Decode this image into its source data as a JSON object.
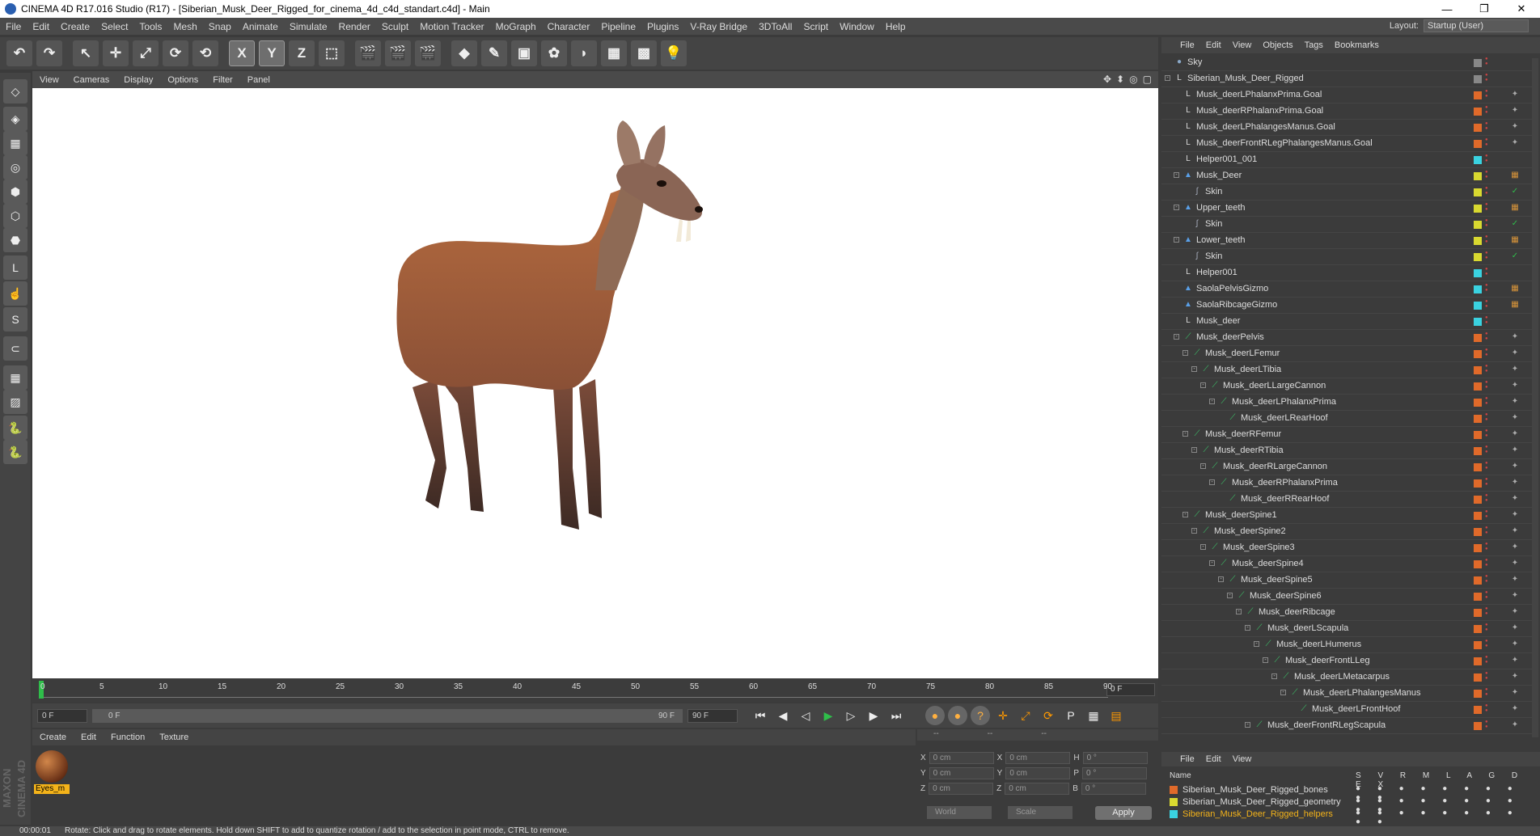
{
  "window": {
    "title": "CINEMA 4D R17.016 Studio (R17) - [Siberian_Musk_Deer_Rigged_for_cinema_4d_c4d_standart.c4d] - Main",
    "controls": [
      "—",
      "❐",
      "✕"
    ]
  },
  "menu": [
    "File",
    "Edit",
    "Create",
    "Select",
    "Tools",
    "Mesh",
    "Snap",
    "Animate",
    "Simulate",
    "Render",
    "Sculpt",
    "Motion Tracker",
    "MoGraph",
    "Character",
    "Pipeline",
    "Plugins",
    "V-Ray Bridge",
    "3DToAll",
    "Script",
    "Window",
    "Help"
  ],
  "layout": {
    "label": "Layout:",
    "value": "Startup (User)"
  },
  "toolbar": {
    "icons": [
      "undo-icon",
      "redo-icon",
      "select-icon",
      "move-icon",
      "scale-icon",
      "rotate-icon",
      "recent-tool-icon",
      "x-axis-icon",
      "y-axis-icon",
      "z-axis-icon",
      "coordinate-system-icon",
      "render-view-icon",
      "render-picture-viewer-icon",
      "render-settings-icon",
      "cube-icon",
      "pen-icon",
      "subdivision-icon",
      "cloner-icon",
      "deformer-icon",
      "floor-icon",
      "camera-icon",
      "light-icon"
    ],
    "glyphs": [
      "↶",
      "↷",
      "↖",
      "✛",
      "⤢",
      "⟳",
      "⟲",
      "X",
      "Y",
      "Z",
      "⬚",
      "🎬",
      "🎬",
      "🎬",
      "◆",
      "✎",
      "▣",
      "✿",
      "◗",
      "▦",
      "▩",
      "💡"
    ]
  },
  "left_tools": [
    "make-editable-icon",
    "model-mode-icon",
    "texture-mode-icon",
    "workplane-icon",
    "points-mode-icon",
    "edges-mode-icon",
    "polygons-mode-icon",
    "axis-mode-icon",
    "tweak-mode-icon",
    "solo-icon",
    "snap-icon",
    "workplane-lock-icon",
    "workplane-align-icon",
    "python-icon",
    "python-script-icon"
  ],
  "left_glyphs": [
    "◇",
    "◈",
    "▦",
    "◎",
    "⬢",
    "⬡",
    "⬣",
    "L",
    "☝",
    "S",
    "⊂",
    "▦",
    "▨",
    "🐍",
    "🐍"
  ],
  "viewport": {
    "menu": [
      "View",
      "Cameras",
      "Display",
      "Options",
      "Filter",
      "Panel"
    ],
    "controls": [
      "✥",
      "⬍",
      "◎",
      "▢"
    ]
  },
  "timeline": {
    "ticks": [
      "0",
      "5",
      "10",
      "15",
      "20",
      "25",
      "30",
      "35",
      "40",
      "45",
      "50",
      "55",
      "60",
      "65",
      "70",
      "75",
      "80",
      "85",
      "90"
    ],
    "current_frame": "0 F"
  },
  "transport": {
    "start_field": "0 F",
    "range_start": "0 F",
    "range_end": "90 F",
    "end_field": "90 F",
    "buttons": [
      "⏮",
      "◀",
      "◁",
      "▶",
      "▷",
      "▶",
      "⏭"
    ]
  },
  "materials": {
    "menu": [
      "Create",
      "Edit",
      "Function",
      "Texture"
    ],
    "items": [
      {
        "name": "Eyes_m"
      }
    ],
    "brand": "MAXON CINEMA 4D"
  },
  "coords": {
    "headers": [
      "--",
      "--",
      "--"
    ],
    "rows": [
      {
        "a": "X",
        "av": "0 cm",
        "b": "X",
        "bv": "0 cm",
        "c": "H",
        "cv": "0 °"
      },
      {
        "a": "Y",
        "av": "0 cm",
        "b": "Y",
        "bv": "0 cm",
        "c": "P",
        "cv": "0 °"
      },
      {
        "a": "Z",
        "av": "0 cm",
        "b": "Z",
        "bv": "0 cm",
        "c": "B",
        "cv": "0 °"
      }
    ],
    "mode1": "World",
    "mode2": "Scale",
    "apply": "Apply"
  },
  "status": {
    "time": "00:00:01",
    "text": "Rotate: Click and drag to rotate elements. Hold down SHIFT to add to quantize rotation / add to the selection in point mode, CTRL to remove."
  },
  "objects": {
    "menu": [
      "File",
      "Edit",
      "View",
      "Objects",
      "Tags",
      "Bookmarks"
    ],
    "rows": [
      {
        "name": "Sky",
        "depth": 0,
        "icon": "sky",
        "color": "#888888",
        "toggle": ""
      },
      {
        "name": "Siberian_Musk_Deer_Rigged",
        "depth": 0,
        "icon": "null",
        "color": "#888888",
        "toggle": "-"
      },
      {
        "name": "Musk_deerLPhalanxPrima.Goal",
        "depth": 1,
        "icon": "null",
        "color": "#e06a2a",
        "toggle": ""
      },
      {
        "name": "Musk_deerRPhalanxPrima.Goal",
        "depth": 1,
        "icon": "null",
        "color": "#e06a2a",
        "toggle": ""
      },
      {
        "name": "Musk_deerLPhalangesManus.Goal",
        "depth": 1,
        "icon": "null",
        "color": "#e06a2a",
        "toggle": ""
      },
      {
        "name": "Musk_deerFrontRLegPhalangesManus.Goal",
        "depth": 1,
        "icon": "null",
        "color": "#e06a2a",
        "toggle": ""
      },
      {
        "name": "Helper001_001",
        "depth": 1,
        "icon": "null",
        "color": "#3ad2e0",
        "toggle": ""
      },
      {
        "name": "Musk_Deer",
        "depth": 1,
        "icon": "poly",
        "color": "#d9d930",
        "toggle": "-"
      },
      {
        "name": "Skin",
        "depth": 2,
        "icon": "skin",
        "color": "#d9d930",
        "toggle": ""
      },
      {
        "name": "Upper_teeth",
        "depth": 1,
        "icon": "poly",
        "color": "#d9d930",
        "toggle": "-"
      },
      {
        "name": "Skin",
        "depth": 2,
        "icon": "skin",
        "color": "#d9d930",
        "toggle": ""
      },
      {
        "name": "Lower_teeth",
        "depth": 1,
        "icon": "poly",
        "color": "#d9d930",
        "toggle": "-"
      },
      {
        "name": "Skin",
        "depth": 2,
        "icon": "skin",
        "color": "#d9d930",
        "toggle": ""
      },
      {
        "name": "Helper001",
        "depth": 1,
        "icon": "null",
        "color": "#3ad2e0",
        "toggle": ""
      },
      {
        "name": "SaolaPelvisGizmo",
        "depth": 1,
        "icon": "poly",
        "color": "#3ad2e0",
        "toggle": ""
      },
      {
        "name": "SaolaRibcageGizmo",
        "depth": 1,
        "icon": "poly",
        "color": "#3ad2e0",
        "toggle": ""
      },
      {
        "name": "Musk_deer",
        "depth": 1,
        "icon": "null",
        "color": "#3ad2e0",
        "toggle": ""
      },
      {
        "name": "Musk_deerPelvis",
        "depth": 1,
        "icon": "bone",
        "color": "#e06a2a",
        "toggle": "-"
      },
      {
        "name": "Musk_deerLFemur",
        "depth": 2,
        "icon": "bone",
        "color": "#e06a2a",
        "toggle": "-"
      },
      {
        "name": "Musk_deerLTibia",
        "depth": 3,
        "icon": "bone",
        "color": "#e06a2a",
        "toggle": "-"
      },
      {
        "name": "Musk_deerLLargeCannon",
        "depth": 4,
        "icon": "bone",
        "color": "#e06a2a",
        "toggle": "-"
      },
      {
        "name": "Musk_deerLPhalanxPrima",
        "depth": 5,
        "icon": "bone",
        "color": "#e06a2a",
        "toggle": "-"
      },
      {
        "name": "Musk_deerLRearHoof",
        "depth": 6,
        "icon": "bone",
        "color": "#e06a2a",
        "toggle": ""
      },
      {
        "name": "Musk_deerRFemur",
        "depth": 2,
        "icon": "bone",
        "color": "#e06a2a",
        "toggle": "-"
      },
      {
        "name": "Musk_deerRTibia",
        "depth": 3,
        "icon": "bone",
        "color": "#e06a2a",
        "toggle": "-"
      },
      {
        "name": "Musk_deerRLargeCannon",
        "depth": 4,
        "icon": "bone",
        "color": "#e06a2a",
        "toggle": "-"
      },
      {
        "name": "Musk_deerRPhalanxPrima",
        "depth": 5,
        "icon": "bone",
        "color": "#e06a2a",
        "toggle": "-"
      },
      {
        "name": "Musk_deerRRearHoof",
        "depth": 6,
        "icon": "bone",
        "color": "#e06a2a",
        "toggle": ""
      },
      {
        "name": "Musk_deerSpine1",
        "depth": 2,
        "icon": "bone",
        "color": "#e06a2a",
        "toggle": "-"
      },
      {
        "name": "Musk_deerSpine2",
        "depth": 3,
        "icon": "bone",
        "color": "#e06a2a",
        "toggle": "-"
      },
      {
        "name": "Musk_deerSpine3",
        "depth": 4,
        "icon": "bone",
        "color": "#e06a2a",
        "toggle": "-"
      },
      {
        "name": "Musk_deerSpine4",
        "depth": 5,
        "icon": "bone",
        "color": "#e06a2a",
        "toggle": "-"
      },
      {
        "name": "Musk_deerSpine5",
        "depth": 6,
        "icon": "bone",
        "color": "#e06a2a",
        "toggle": "-"
      },
      {
        "name": "Musk_deerSpine6",
        "depth": 7,
        "icon": "bone",
        "color": "#e06a2a",
        "toggle": "-"
      },
      {
        "name": "Musk_deerRibcage",
        "depth": 8,
        "icon": "bone",
        "color": "#e06a2a",
        "toggle": "-"
      },
      {
        "name": "Musk_deerLScapula",
        "depth": 9,
        "icon": "bone",
        "color": "#e06a2a",
        "toggle": "-"
      },
      {
        "name": "Musk_deerLHumerus",
        "depth": 10,
        "icon": "bone",
        "color": "#e06a2a",
        "toggle": "-"
      },
      {
        "name": "Musk_deerFrontLLeg",
        "depth": 11,
        "icon": "bone",
        "color": "#e06a2a",
        "toggle": "-"
      },
      {
        "name": "Musk_deerLMetacarpus",
        "depth": 12,
        "icon": "bone",
        "color": "#e06a2a",
        "toggle": "-"
      },
      {
        "name": "Musk_deerLPhalangesManus",
        "depth": 13,
        "icon": "bone",
        "color": "#e06a2a",
        "toggle": "-"
      },
      {
        "name": "Musk_deerLFrontHoof",
        "depth": 14,
        "icon": "bone",
        "color": "#e06a2a",
        "toggle": ""
      },
      {
        "name": "Musk_deerFrontRLegScapula",
        "depth": 9,
        "icon": "bone",
        "color": "#e06a2a",
        "toggle": "-"
      }
    ]
  },
  "layers": {
    "menu": [
      "File",
      "Edit",
      "View"
    ],
    "headers": {
      "name": "Name",
      "flags": "S V R M L A G D E X"
    },
    "rows": [
      {
        "name": "Siberian_Musk_Deer_Rigged_bones",
        "color": "#e06a2a",
        "text_color": "#dddddd"
      },
      {
        "name": "Siberian_Musk_Deer_Rigged_geometry",
        "color": "#d9d930",
        "text_color": "#dddddd"
      },
      {
        "name": "Siberian_Musk_Deer_Rigged_helpers",
        "color": "#3ad2e0",
        "text_color": "#f4b31a"
      }
    ]
  }
}
